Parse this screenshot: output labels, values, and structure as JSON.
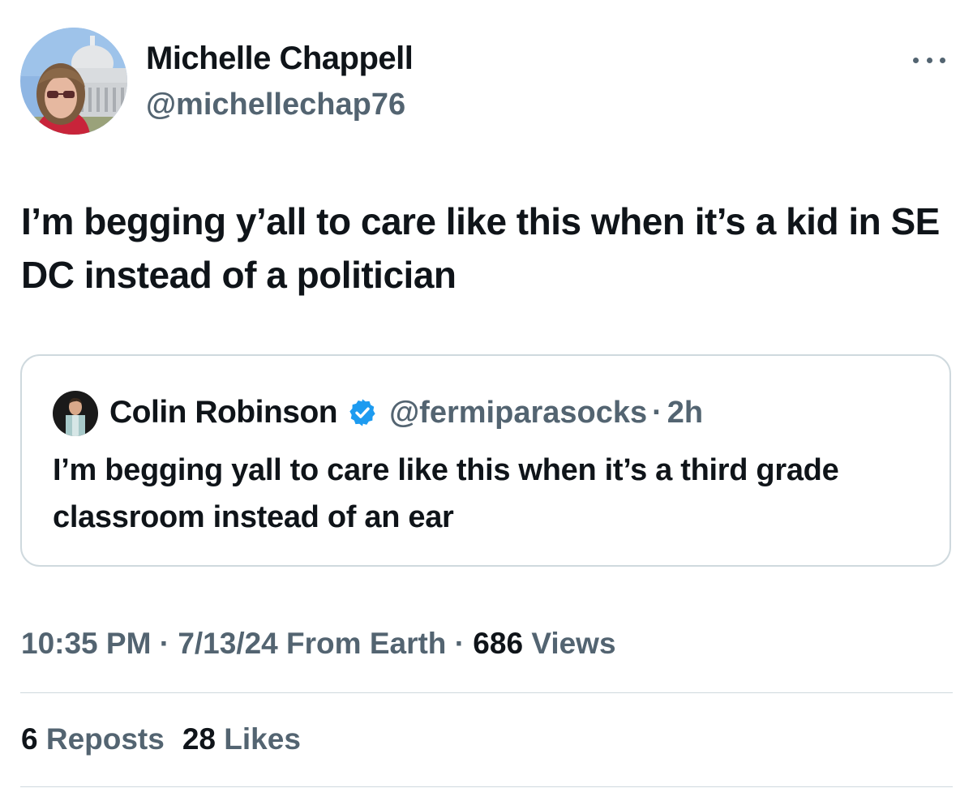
{
  "author": {
    "display_name": "Michelle Chappell",
    "handle": "@michellechap76"
  },
  "tweet": {
    "text": "I’m begging y’all to care like this when it’s a kid in SE DC instead of a politician"
  },
  "quoted_tweet": {
    "display_name": "Colin Robinson",
    "handle": "@fermiparasocks",
    "separator": "·",
    "time": "2h",
    "text": "I’m begging yall to care like this when it’s a third grade classroom instead of an ear",
    "verified_icon": "verified-badge-icon",
    "verified_color": "#1d9bf0"
  },
  "meta": {
    "time": "10:35 PM",
    "separator_1": "·",
    "date": "7/13/24",
    "source": "From Earth",
    "separator_2": "·",
    "views_count": "686",
    "views_label": "Views"
  },
  "stats": {
    "reposts_count": "6",
    "reposts_label": "Reposts",
    "likes_count": "28",
    "likes_label": "Likes"
  },
  "colors": {
    "text_primary": "#0f1419",
    "text_secondary": "#536471",
    "border": "#cfd9de"
  }
}
